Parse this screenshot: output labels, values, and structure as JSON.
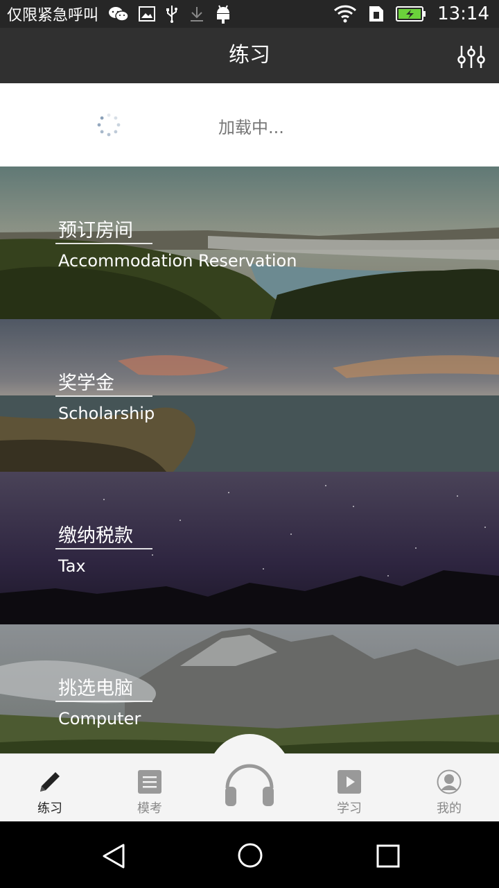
{
  "status_bar": {
    "carrier_text": "仅限紧急呼叫",
    "time": "13:14"
  },
  "app_bar": {
    "title": "练习"
  },
  "loading": {
    "text": "加载中..."
  },
  "cards": [
    {
      "title_zh": "预订房间",
      "title_en": "Accommodation Reservation"
    },
    {
      "title_zh": "奖学金",
      "title_en": "Scholarship"
    },
    {
      "title_zh": "缴纳税款",
      "title_en": "Tax"
    },
    {
      "title_zh": "挑选电脑",
      "title_en": "Computer"
    }
  ],
  "tabs": [
    {
      "label": "练习",
      "icon": "pencil-icon",
      "active": true
    },
    {
      "label": "模考",
      "icon": "document-icon",
      "active": false
    },
    {
      "label": "",
      "icon": "headphones-icon",
      "active": false
    },
    {
      "label": "学习",
      "icon": "play-icon",
      "active": false
    },
    {
      "label": "我的",
      "icon": "user-icon",
      "active": false
    }
  ],
  "colors": {
    "app_bar": "#303030",
    "status_bar": "#262626",
    "tab_bar": "#f4f4f4",
    "tab_icon": "#999999",
    "tab_active": "#222222"
  }
}
